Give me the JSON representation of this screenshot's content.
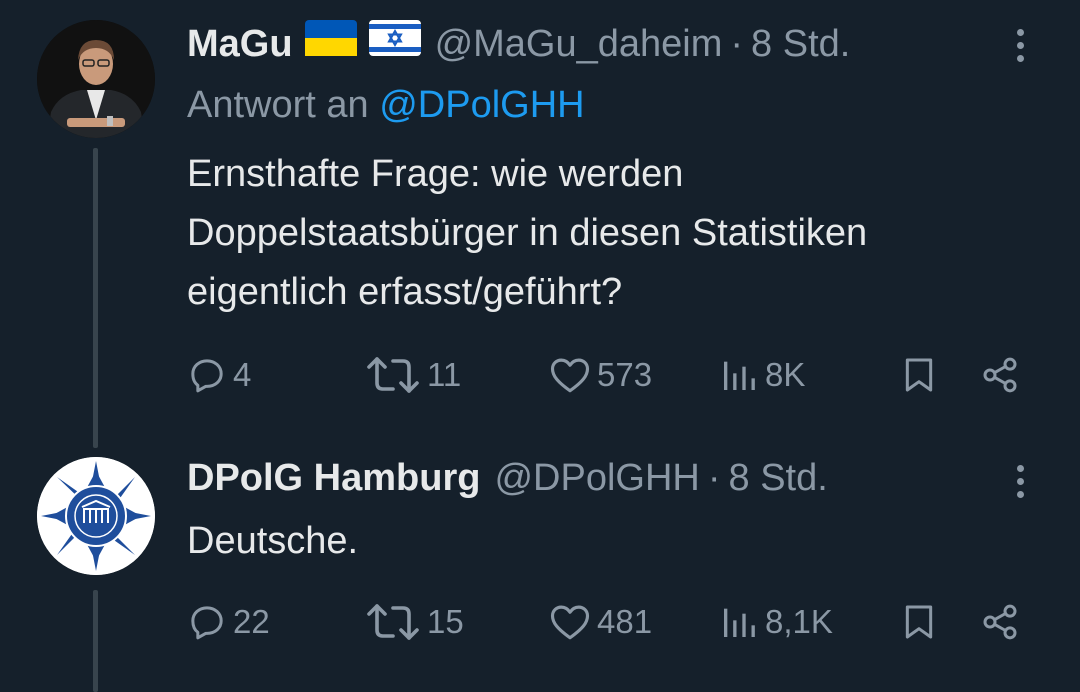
{
  "tweets": [
    {
      "display_name": "MaGu",
      "flags": [
        "🇺🇦",
        "🇮🇱"
      ],
      "handle": "@MaGu_daheim",
      "separator": "·",
      "time": "8 Std.",
      "reply_prefix": "Antwort an",
      "reply_to": "@DPolGHH",
      "text": "Ernsthafte Frage: wie werden\nDoppelstaatsbürger in diesen Statistiken\neigentlich erfasst/geführt?",
      "replies": "4",
      "retweets": "11",
      "likes": "573",
      "views": "8K"
    },
    {
      "display_name": "DPolG Hamburg",
      "handle": "@DPolGHH",
      "separator": "·",
      "time": "8 Std.",
      "text": "Deutsche.",
      "replies": "22",
      "retweets": "15",
      "likes": "481",
      "views": "8,1K"
    }
  ],
  "colors": {
    "background": "#15202b",
    "text": "#e7e9ea",
    "secondary": "#8b98a5",
    "link": "#1d9bf0",
    "thread_line": "#38444d"
  },
  "icons": [
    "reply-icon",
    "retweet-icon",
    "like-icon",
    "views-icon",
    "bookmark-icon",
    "share-icon",
    "more-icon"
  ]
}
